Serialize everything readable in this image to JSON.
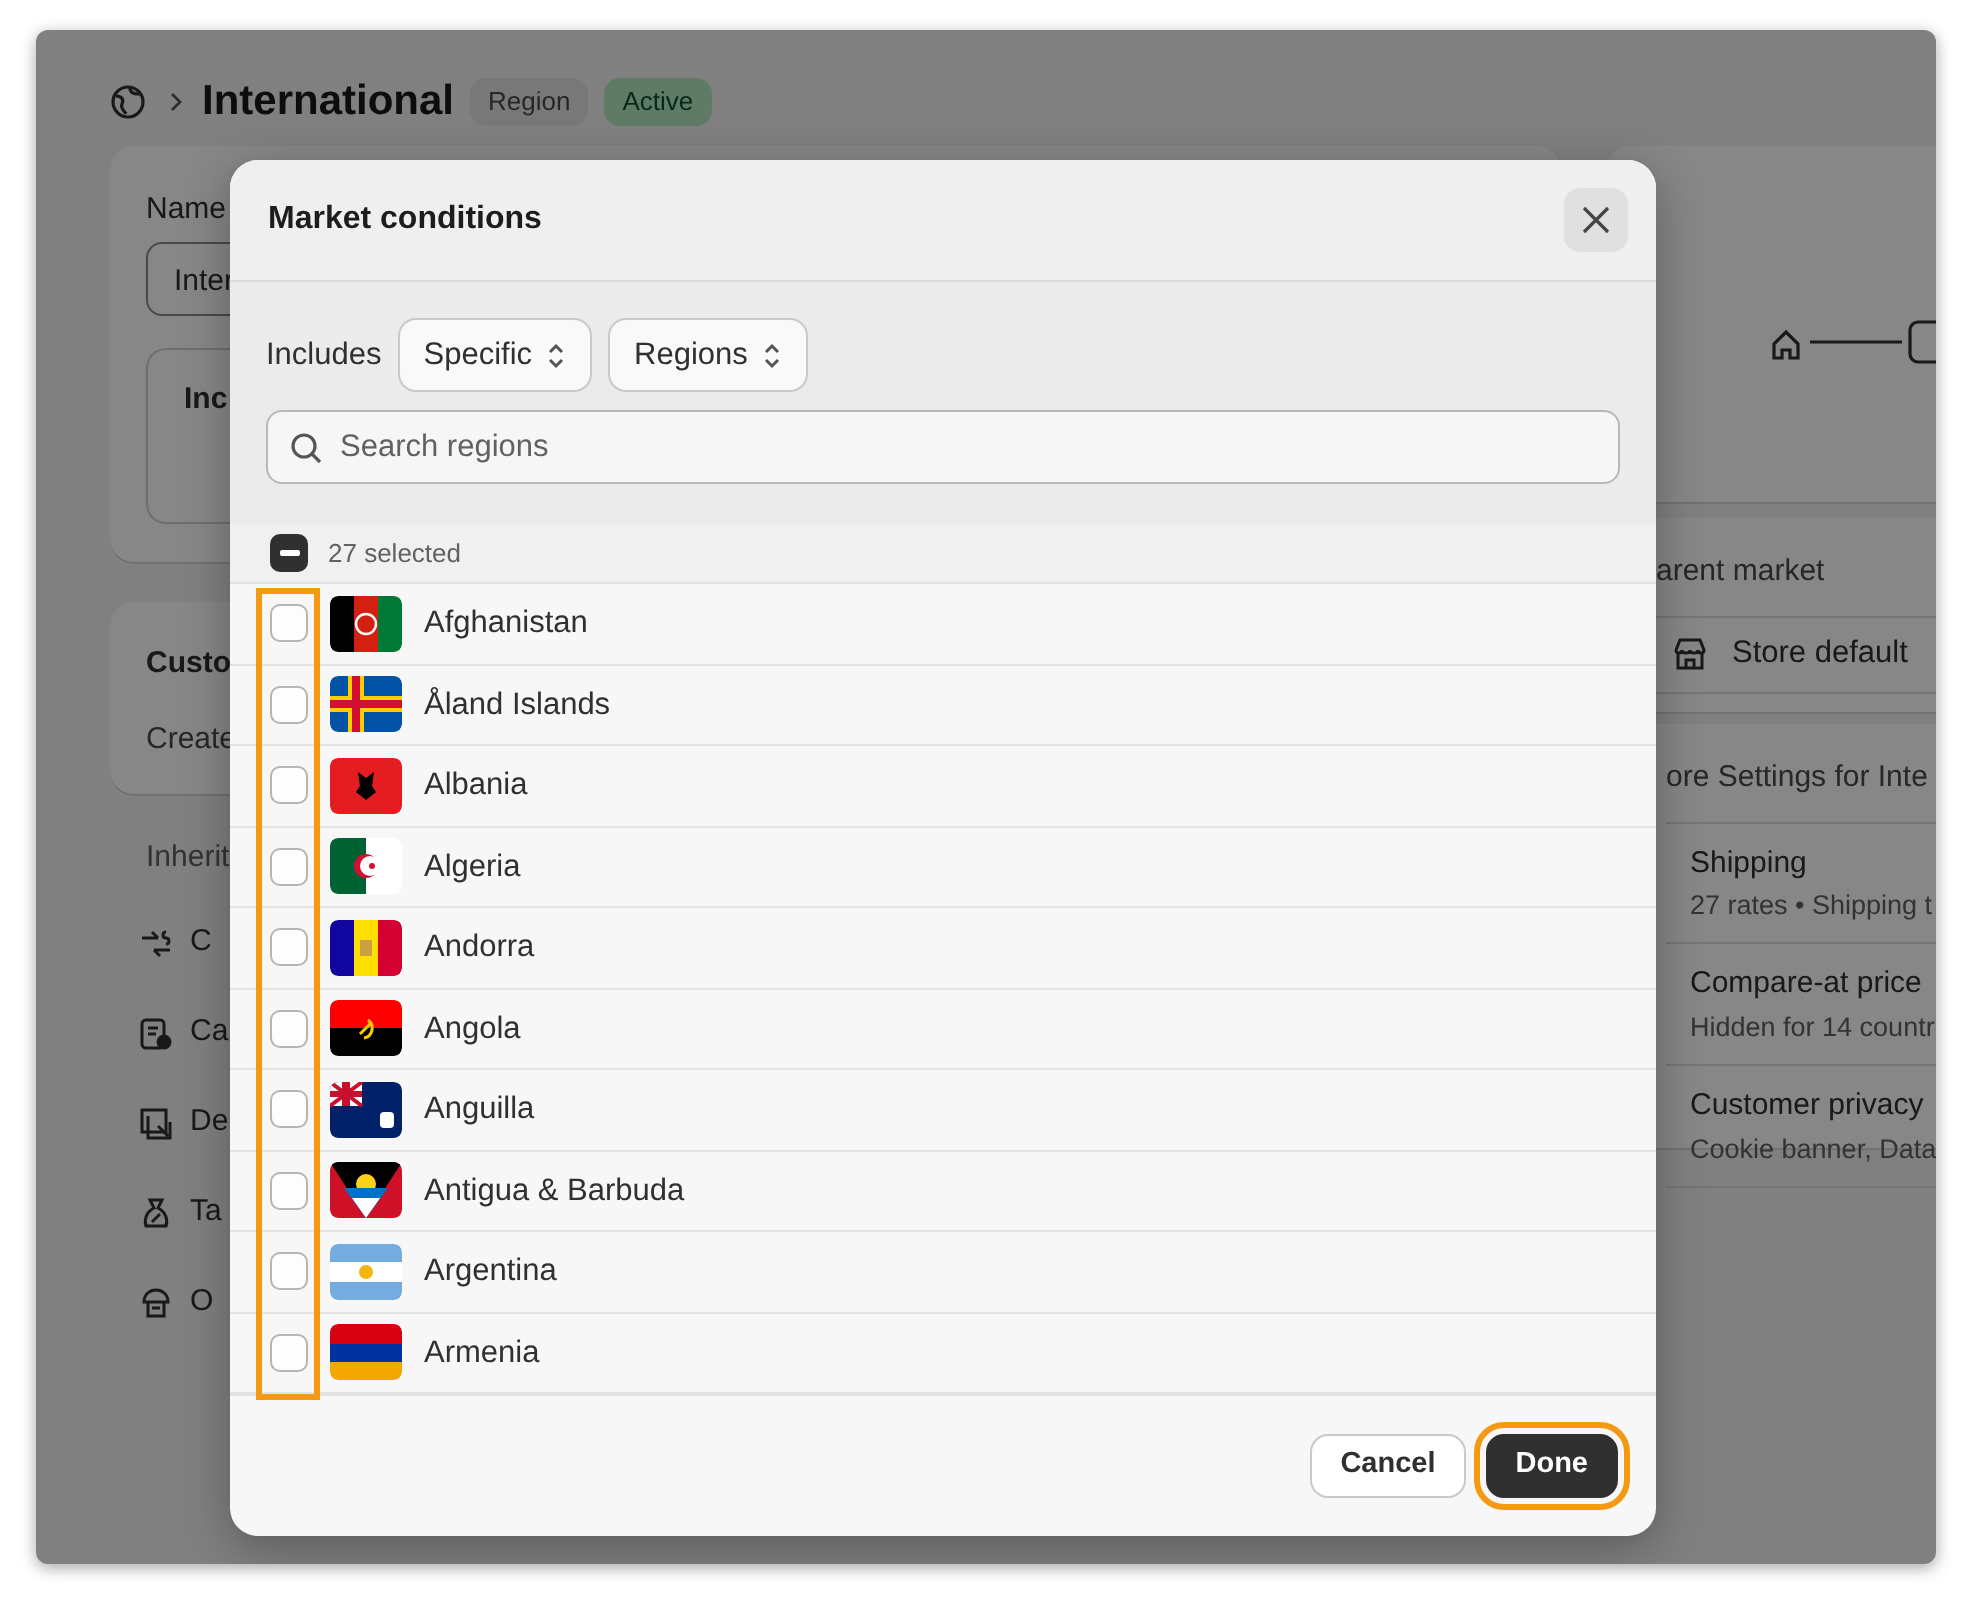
{
  "page": {
    "title": "International",
    "badges": [
      {
        "label": "Region",
        "kind": "neutral"
      },
      {
        "label": "Active",
        "kind": "success"
      }
    ],
    "left": {
      "name_label": "Name",
      "name_value": "Inter",
      "inner_label": "Inc",
      "card_title": "Custo",
      "card_text": "Create",
      "section_label": "Inherit",
      "items": [
        "C",
        "Ca",
        "De",
        "Ta",
        "O"
      ]
    },
    "right": {
      "parent_label": "arent market",
      "parent_value": "Store default",
      "settings_title": "ore Settings for Inte",
      "settings": [
        {
          "title": "Shipping",
          "detail": "27 rates • Shipping t"
        },
        {
          "title": "Compare-at price",
          "detail": "Hidden for 14 countr"
        },
        {
          "title": "Customer privacy",
          "detail": "Cookie banner, Data"
        }
      ]
    }
  },
  "dialog": {
    "title": "Market conditions",
    "includes_label": "Includes",
    "selects": [
      "Specific",
      "Regions"
    ],
    "search": {
      "placeholder": "Search regions"
    },
    "selection": {
      "label": "27 selected",
      "indeterminate": true
    },
    "checkboxes_highlighted": true,
    "regions": [
      {
        "name": "Afghanistan",
        "checked": false
      },
      {
        "name": "Åland Islands",
        "checked": false
      },
      {
        "name": "Albania",
        "checked": false
      },
      {
        "name": "Algeria",
        "checked": false
      },
      {
        "name": "Andorra",
        "checked": false
      },
      {
        "name": "Angola",
        "checked": false
      },
      {
        "name": "Anguilla",
        "checked": false
      },
      {
        "name": "Antigua & Barbuda",
        "checked": false
      },
      {
        "name": "Argentina",
        "checked": false
      },
      {
        "name": "Armenia",
        "checked": false
      }
    ],
    "buttons": [
      {
        "label": "Cancel",
        "kind": "secondary",
        "highlighted": false
      },
      {
        "label": "Done",
        "kind": "primary",
        "highlighted": true
      }
    ]
  }
}
